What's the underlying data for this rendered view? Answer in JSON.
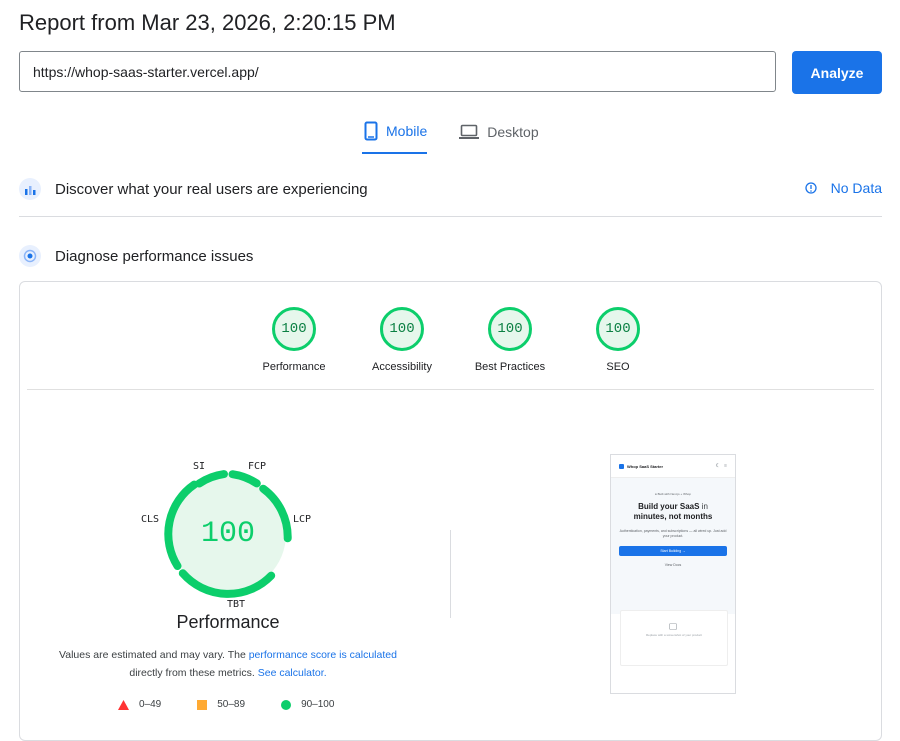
{
  "header": {
    "title": "Report from Mar 23, 2026, 2:20:15 PM",
    "url_value": "https://whop-saas-starter.vercel.app/",
    "analyze_label": "Analyze"
  },
  "tabs": [
    {
      "label": "Mobile",
      "icon": "mobile-icon",
      "active": true
    },
    {
      "label": "Desktop",
      "icon": "desktop-icon",
      "active": false
    }
  ],
  "field_data": {
    "title": "Discover what your real users are experiencing",
    "status": "No Data"
  },
  "diagnose": {
    "title": "Diagnose performance issues"
  },
  "category_scores": [
    {
      "label": "Performance",
      "score": "100"
    },
    {
      "label": "Accessibility",
      "score": "100"
    },
    {
      "label": "Best Practices",
      "score": "100"
    },
    {
      "label": "SEO",
      "score": "100"
    }
  ],
  "performance": {
    "score": "100",
    "title": "Performance",
    "metrics": [
      "SI",
      "FCP",
      "LCP",
      "TBT",
      "CLS"
    ],
    "note_prefix": "Values are estimated and may vary. The ",
    "note_link1": "performance score is calculated",
    "note_mid": " directly from these metrics. ",
    "note_link2": "See calculator.",
    "legend": [
      {
        "range": "0–49",
        "shape": "triangle",
        "color": "#ff3333"
      },
      {
        "range": "50–89",
        "shape": "square",
        "color": "#ffaa33"
      },
      {
        "range": "90–100",
        "shape": "circle",
        "color": "#0cce6b"
      }
    ]
  },
  "screenshot": {
    "app_name": "Whop SaaS Starter",
    "badge": "● Built with Next.js + Whop",
    "headline_bold": "Build your SaaS",
    "headline_light": "in",
    "headline_line2": "minutes, not months",
    "subtext": "Authentication, payments, and subscriptions — all wired up. Just add your product.",
    "primary_cta": "Start Building →",
    "secondary_cta": "View Docs",
    "placeholder": "Replace with a screenshot of your product"
  },
  "colors": {
    "accent": "#1a73e8",
    "pass": "#0cce6b",
    "pass_text": "#0b8043"
  }
}
